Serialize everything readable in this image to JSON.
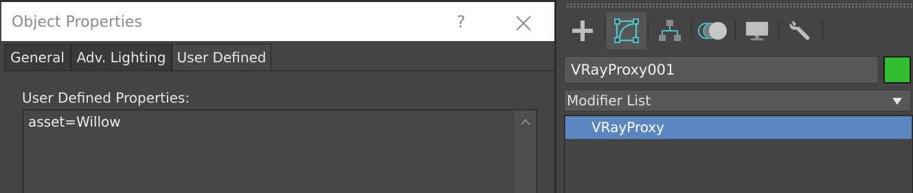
{
  "dialog": {
    "title": "Object Properties",
    "help_label": "?",
    "tabs": [
      {
        "label": "General"
      },
      {
        "label": "Adv. Lighting"
      },
      {
        "label": "User Defined"
      }
    ],
    "active_tab": "User Defined",
    "user_defined": {
      "label": "User Defined Properties:",
      "value": "asset=Willow"
    }
  },
  "command_panel": {
    "tabs": [
      {
        "icon": "plus-icon",
        "name": "Create"
      },
      {
        "icon": "modify-icon",
        "name": "Modify",
        "active": true
      },
      {
        "icon": "hierarchy-icon",
        "name": "Hierarchy"
      },
      {
        "icon": "motion-icon",
        "name": "Motion"
      },
      {
        "icon": "display-icon",
        "name": "Display"
      },
      {
        "icon": "wrench-icon",
        "name": "Utilities"
      }
    ],
    "object_name": "VRayProxy001",
    "object_color": "#2fbf2f",
    "modifier_list_label": "Modifier List",
    "stack_items": [
      {
        "label": "VRayProxy",
        "selected": true
      }
    ]
  },
  "colors": {
    "accent_teal": "#4fc3c8",
    "selection_blue": "#5b87c0",
    "background": "#444444"
  }
}
